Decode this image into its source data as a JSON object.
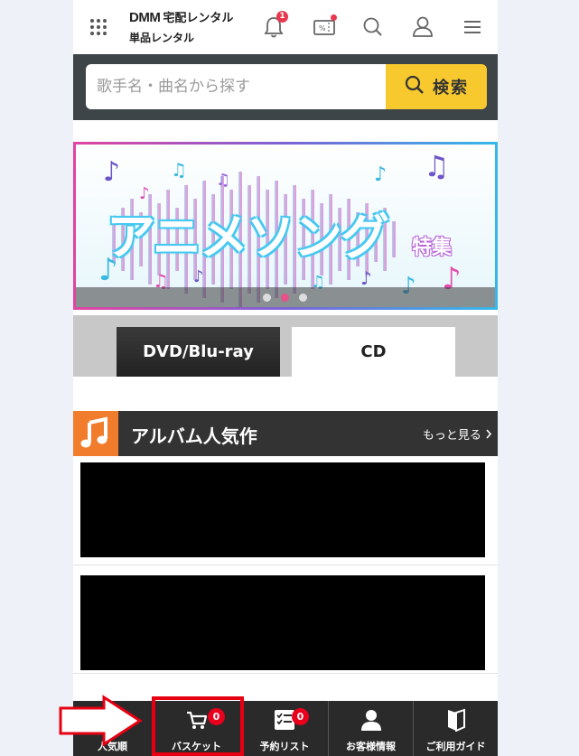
{
  "header": {
    "logo_brand": "DMM",
    "logo_service": "宅配レンタル",
    "logo_sub": "単品レンタル",
    "notification_count": "1"
  },
  "search": {
    "placeholder": "歌手名・曲名から探す",
    "button_label": "検索"
  },
  "banner": {
    "title": "アニメソング",
    "subtitle": "特集",
    "slides": 3,
    "active_slide": 2
  },
  "tabs": [
    {
      "label": "DVD/Blu-ray",
      "active": false
    },
    {
      "label": "CD",
      "active": true
    }
  ],
  "section": {
    "title": "アルバム人気作",
    "more_label": "もっと見る"
  },
  "bottom_nav": {
    "items": [
      {
        "label": "人気順"
      },
      {
        "label": "バスケット",
        "badge": "0"
      },
      {
        "label": "予約リスト",
        "badge": "0"
      },
      {
        "label": "お客様情報"
      },
      {
        "label": "ご利用ガイド"
      }
    ]
  },
  "colors": {
    "accent_yellow": "#f7c92e",
    "dark_bar": "#3d4548",
    "section_orange": "#f07c2c",
    "highlight_red": "#e60012",
    "badge_red": "#e8001c"
  }
}
